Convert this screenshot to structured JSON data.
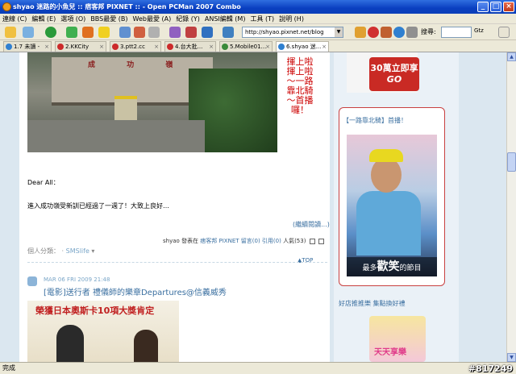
{
  "window": {
    "title": "shyao 迷路的小魚兒 :: 痞客邦 PIXNET :: - Open PCMan 2007 Combo"
  },
  "menu": [
    "連線 (C)",
    "編輯 (E)",
    "選項 (O)",
    "BBS最愛 (B)",
    "Web最愛 (A)",
    "紀錄 (Y)",
    "ANSI編輯 (M)",
    "工具 (T)",
    "說明 (H)"
  ],
  "address": {
    "url": "http://shyao.pixnet.net/blog"
  },
  "search": {
    "label": "搜尋:",
    "engine": "Gtz"
  },
  "tabs": [
    "1.7 未讀 -",
    "2.KKCity",
    "3.ptt2.cc",
    "4.台大批...",
    "5.Mobile01...",
    "6.shyao 迷..."
  ],
  "post1": {
    "photo_text": "成 功 嶺",
    "callout": "揮上啦揮上啦～一路靠北騎～首播囉！",
    "greeting": "Dear All：",
    "body": "進入成功嶺受新訓已經過了一週了！大致上良好…",
    "read_more": "(繼續閱讀...)",
    "meta": {
      "author": "shyao",
      "posted_in": "發表在",
      "blog": "痞客邦 PIXNET",
      "comments": "留言(0)",
      "trackback": "引用(0)",
      "views": "人氣(53)"
    },
    "category_label": "個人分類：",
    "category": "SMSlife",
    "top": "TOP"
  },
  "post2": {
    "date": "MAR 06 FRI 2009 21:48",
    "title": "[電影]送行者 禮儀師的樂章Departures@信義威秀",
    "poster_text": "榮獲日本奧斯卡10項大獎肯定"
  },
  "sidebar": {
    "ad": {
      "line1": "30萬立即享",
      "line2": "GO"
    },
    "widget": {
      "title": "【一路靠北騎】首播！",
      "caption_pre": "最多",
      "caption_big": "歡笑",
      "caption_post": "的節目"
    },
    "section_title": "好店推推樂 集點換好禮",
    "ad2": "天天享樂"
  },
  "status": {
    "text": "完成",
    "watermark": "#817249"
  }
}
